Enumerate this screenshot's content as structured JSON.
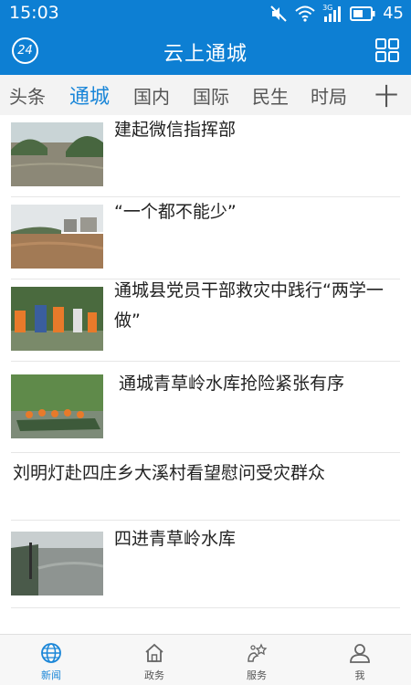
{
  "status_bar": {
    "time": "15:03",
    "network": "3G",
    "battery": "45"
  },
  "app_bar": {
    "logo_text": "24",
    "title": "云上通城"
  },
  "tabs": [
    {
      "label": "头条"
    },
    {
      "label": "通城",
      "active": true
    },
    {
      "label": "国内"
    },
    {
      "label": "国际"
    },
    {
      "label": "民生"
    },
    {
      "label": "时局"
    }
  ],
  "tab_add_label": "十",
  "news": [
    {
      "title": "建起微信指挥部"
    },
    {
      "title": "“一个都不能少”"
    },
    {
      "title": "通城县党员干部救灾中践行“两学一做”"
    },
    {
      "title": "通城青草岭水库抢险紧张有序"
    },
    {
      "title": "刘明灯赴四庄乡大溪村看望慰问受灾群众"
    },
    {
      "title": "四进青草岭水库"
    }
  ],
  "bottom_nav": [
    {
      "label": "新闻",
      "icon": "globe-icon",
      "active": true
    },
    {
      "label": "政务",
      "icon": "home-icon"
    },
    {
      "label": "服务",
      "icon": "service-icon"
    },
    {
      "label": "我",
      "icon": "person-icon"
    }
  ],
  "colors": {
    "primary": "#0d7fd3",
    "accent": "#1a86d8"
  }
}
